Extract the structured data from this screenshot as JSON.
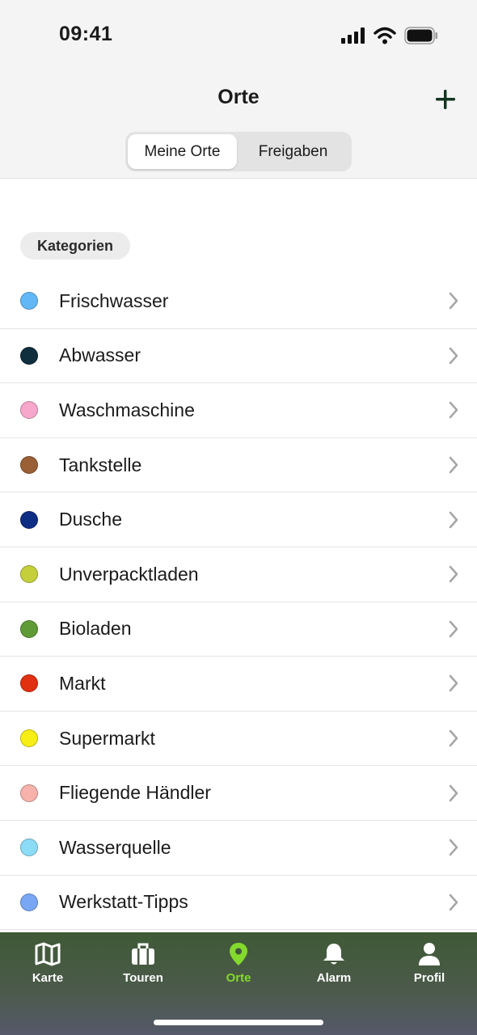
{
  "status": {
    "time": "09:41"
  },
  "header": {
    "title": "Orte",
    "add_icon": "plus-icon",
    "segments": [
      {
        "label": "Meine Orte",
        "active": true
      },
      {
        "label": "Freigaben",
        "active": false
      }
    ]
  },
  "section": {
    "label": "Kategorien"
  },
  "categories": [
    {
      "label": "Frischwasser",
      "color": "#62b8f7"
    },
    {
      "label": "Abwasser",
      "color": "#0f2e3e"
    },
    {
      "label": "Waschmaschine",
      "color": "#f7a7cb"
    },
    {
      "label": "Tankstelle",
      "color": "#9a5f35"
    },
    {
      "label": "Dusche",
      "color": "#0d2d85"
    },
    {
      "label": "Unverpacktladen",
      "color": "#c4cf3b"
    },
    {
      "label": "Bioladen",
      "color": "#5f9b37"
    },
    {
      "label": "Markt",
      "color": "#e12f12"
    },
    {
      "label": "Supermarkt",
      "color": "#f6ee14"
    },
    {
      "label": "Fliegende Händler",
      "color": "#f6b2ab"
    },
    {
      "label": "Wasserquelle",
      "color": "#8cdcf7"
    },
    {
      "label": "Werkstatt-Tipps",
      "color": "#79a7f4"
    }
  ],
  "tabbar": {
    "active_color": "#84d92d",
    "items": [
      {
        "label": "Karte",
        "icon": "map-icon"
      },
      {
        "label": "Touren",
        "icon": "suitcase-icon"
      },
      {
        "label": "Orte",
        "icon": "location-pin-icon",
        "active": true
      },
      {
        "label": "Alarm",
        "icon": "bell-icon"
      },
      {
        "label": "Profil",
        "icon": "person-icon"
      }
    ]
  }
}
